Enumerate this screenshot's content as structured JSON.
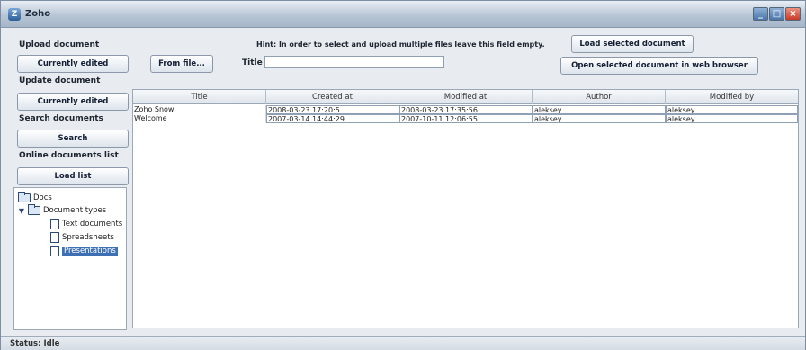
{
  "window": {
    "title": "Zoho"
  },
  "sections": {
    "upload": "Upload document",
    "update": "Update document",
    "search": "Search documents",
    "online": "Online documents list"
  },
  "buttons": {
    "upload_currently_edited": "Currently edited",
    "from_file": "From file...",
    "update_currently_edited": "Currently edited",
    "search": "Search",
    "load_list": "Load list",
    "load_selected": "Load selected document",
    "open_selected_web": "Open selected document in web browser"
  },
  "hint": "Hint: In order to select and upload multiple files leave this field empty.",
  "title_field": {
    "label": "Title",
    "value": ""
  },
  "tree": {
    "root": "Docs",
    "types": "Document types",
    "children": [
      "Text documents",
      "Spreadsheets",
      "Presentations"
    ],
    "selected_index": 2
  },
  "table": {
    "columns": [
      "Title",
      "Created at",
      "Modified at",
      "Author",
      "Modified by"
    ],
    "rows": [
      [
        "Zoho Snow",
        "2008-03-23 17:20:5",
        "2008-03-23 17:35:56",
        "aleksey",
        "aleksey"
      ],
      [
        "Welcome",
        "2007-03-14 14:44:29",
        "2007-10-11 12:06:55",
        "aleksey",
        "aleksey"
      ]
    ]
  },
  "status": "Status: Idle"
}
